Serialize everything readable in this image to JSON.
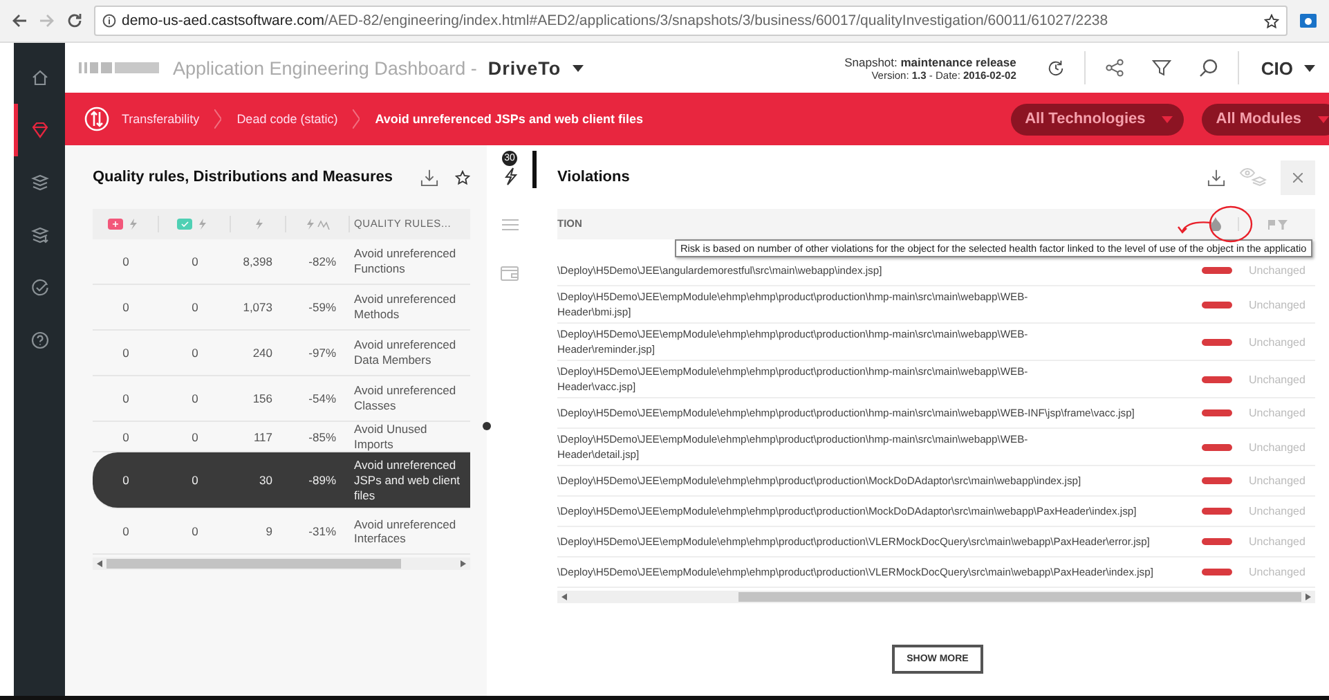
{
  "browser": {
    "url_host": "demo-us-aed.castsoftware.com",
    "url_path": "/AED-82/engineering/index.html#AED2/applications/3/snapshots/3/business/60017/qualityInvestigation/60011/61027/2238"
  },
  "sidebar": {
    "items": [
      {
        "selected": false
      },
      {
        "selected": true
      },
      {
        "selected": false
      },
      {
        "selected": false
      },
      {
        "selected": false
      },
      {
        "selected": false
      }
    ]
  },
  "header": {
    "title": "Application Engineering Dashboard - ",
    "app": "DriveTo",
    "snapshot_label": "Snapshot: ",
    "snapshot": "maintenance release",
    "version_label": "Version: ",
    "version": "1.3",
    "date_label": " - Date: ",
    "date": "2016-02-02",
    "user": "CIO"
  },
  "breadcrumbs": [
    {
      "label": "Transferability",
      "current": false
    },
    {
      "label": "Dead code (static)",
      "current": false
    },
    {
      "label": "Avoid unreferenced JSPs and web client files",
      "current": true
    }
  ],
  "filters": [
    "All Technologies",
    "All Modules"
  ],
  "rules_panel": {
    "title": "Quality rules, Distributions and Measures",
    "last_column": "QUALITY RULES...",
    "rows": [
      {
        "added": "0",
        "removed": "0",
        "total": "8,398",
        "trend": "-82%",
        "rule": "Avoid unreferenced Functions",
        "selected": false
      },
      {
        "added": "0",
        "removed": "0",
        "total": "1,073",
        "trend": "-59%",
        "rule": "Avoid unreferenced Methods",
        "selected": false
      },
      {
        "added": "0",
        "removed": "0",
        "total": "240",
        "trend": "-97%",
        "rule": "Avoid unreferenced Data Members",
        "selected": false
      },
      {
        "added": "0",
        "removed": "0",
        "total": "156",
        "trend": "-54%",
        "rule": "Avoid unreferenced Classes",
        "selected": false
      },
      {
        "added": "0",
        "removed": "0",
        "total": "117",
        "trend": "-85%",
        "rule": "Avoid Unused Imports",
        "selected": false
      },
      {
        "added": "0",
        "removed": "0",
        "total": "30",
        "trend": "-89%",
        "rule": "Avoid unreferenced JSPs and web client files",
        "selected": true
      },
      {
        "added": "0",
        "removed": "0",
        "total": "9",
        "trend": "-31%",
        "rule": "Avoid unreferenced Interfaces",
        "selected": false
      }
    ]
  },
  "violation_count": "30",
  "violations": {
    "title": "Violations",
    "column_1": "TION",
    "tooltip": "Risk is based on number of other violations for the object for the selected health factor linked to the level of use of the object in the applicatio",
    "rows": [
      {
        "lines": [
          "\\Deploy\\H5Demo\\JEE\\angulardemorestful\\src\\main\\webapp\\index.jsp]"
        ],
        "status": "Unchanged"
      },
      {
        "lines": [
          "\\Deploy\\H5Demo\\JEE\\empModule\\ehmp\\ehmp\\product\\production\\hmp-main\\src\\main\\webapp\\WEB-",
          "Header\\bmi.jsp]"
        ],
        "status": "Unchanged"
      },
      {
        "lines": [
          "\\Deploy\\H5Demo\\JEE\\empModule\\ehmp\\ehmp\\product\\production\\hmp-main\\src\\main\\webapp\\WEB-",
          "Header\\reminder.jsp]"
        ],
        "status": "Unchanged"
      },
      {
        "lines": [
          "\\Deploy\\H5Demo\\JEE\\empModule\\ehmp\\ehmp\\product\\production\\hmp-main\\src\\main\\webapp\\WEB-",
          "Header\\vacc.jsp]"
        ],
        "status": "Unchanged"
      },
      {
        "lines": [
          "\\Deploy\\H5Demo\\JEE\\empModule\\ehmp\\ehmp\\product\\production\\hmp-main\\src\\main\\webapp\\WEB-INF\\jsp\\frame\\vacc.jsp]"
        ],
        "status": "Unchanged"
      },
      {
        "lines": [
          "\\Deploy\\H5Demo\\JEE\\empModule\\ehmp\\ehmp\\product\\production\\hmp-main\\src\\main\\webapp\\WEB-",
          "Header\\detail.jsp]"
        ],
        "status": "Unchanged"
      },
      {
        "lines": [
          "\\Deploy\\H5Demo\\JEE\\empModule\\ehmp\\ehmp\\product\\production\\MockDoDAdaptor\\src\\main\\webapp\\index.jsp]"
        ],
        "status": "Unchanged"
      },
      {
        "lines": [
          "\\Deploy\\H5Demo\\JEE\\empModule\\ehmp\\ehmp\\product\\production\\MockDoDAdaptor\\src\\main\\webapp\\PaxHeader\\index.jsp]"
        ],
        "status": "Unchanged"
      },
      {
        "lines": [
          "\\Deploy\\H5Demo\\JEE\\empModule\\ehmp\\ehmp\\product\\production\\VLERMockDocQuery\\src\\main\\webapp\\PaxHeader\\error.jsp]"
        ],
        "status": "Unchanged"
      },
      {
        "lines": [
          "\\Deploy\\H5Demo\\JEE\\empModule\\ehmp\\ehmp\\product\\production\\VLERMockDocQuery\\src\\main\\webapp\\PaxHeader\\index.jsp]"
        ],
        "status": "Unchanged"
      }
    ],
    "more_button": "SHOW MORE"
  }
}
